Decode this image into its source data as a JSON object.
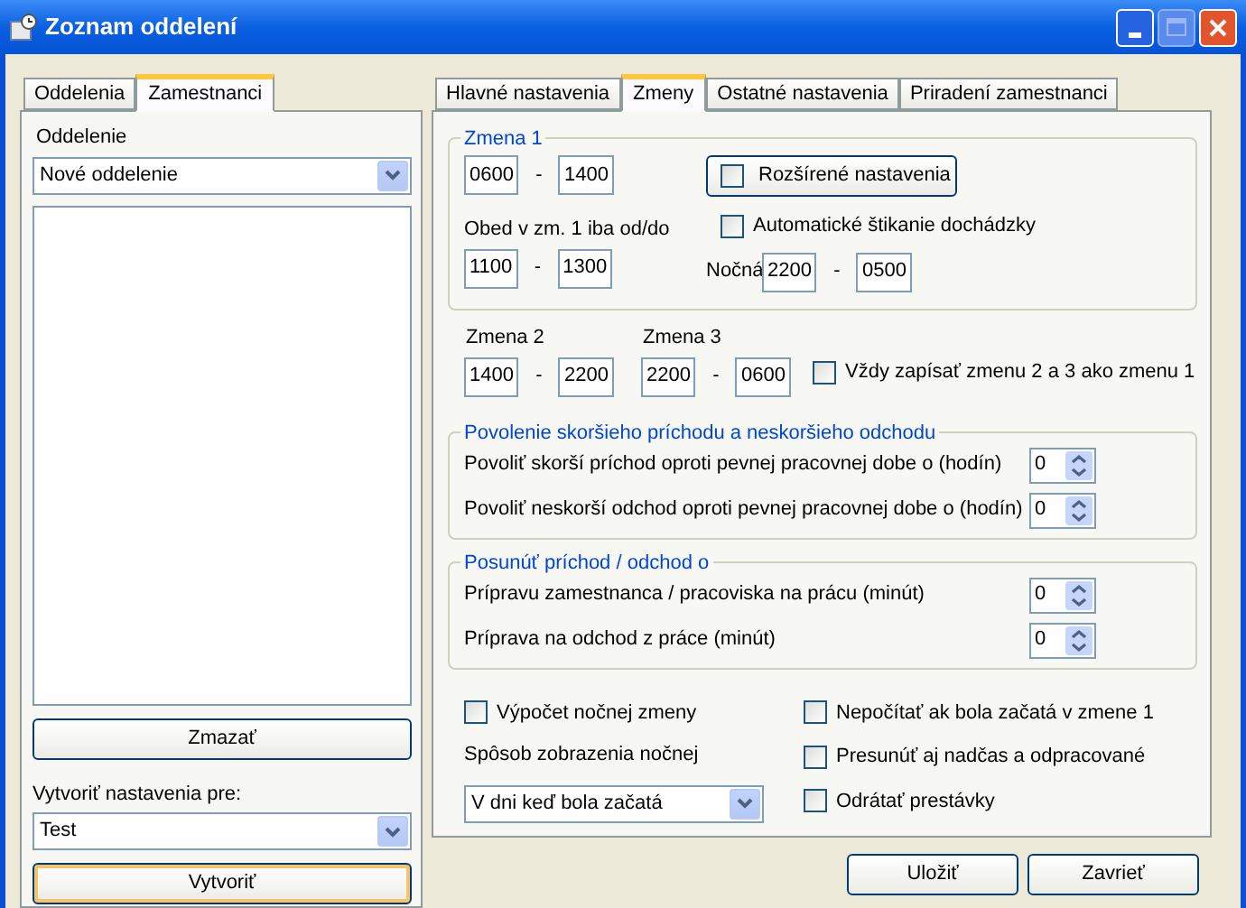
{
  "window": {
    "title": "Zoznam oddelení"
  },
  "left_tabs": [
    {
      "label": "Oddelenia",
      "selected": false
    },
    {
      "label": "Zamestnanci",
      "selected": true
    }
  ],
  "department": {
    "label": "Oddelenie",
    "value": "Nové oddelenie"
  },
  "delete_button": "Zmazať",
  "create_for": {
    "label": "Vytvoriť nastavenia pre:",
    "value": "Test"
  },
  "create_button": "Vytvoriť",
  "right_tabs": [
    {
      "label": "Hlavné nastavenia",
      "selected": false
    },
    {
      "label": "Zmeny",
      "selected": true
    },
    {
      "label": "Ostatné nastavenia",
      "selected": false
    },
    {
      "label": "Priradení zamestnanci",
      "selected": false
    }
  ],
  "shift1": {
    "title": "Zmena 1",
    "from": "0600",
    "to": "1400",
    "separator": "-",
    "advanced": {
      "label": "Rozšírené nastavenia",
      "checked": false
    },
    "lunch": {
      "label": "Obed v zm. 1 iba od/do",
      "from": "1100",
      "to": "1300"
    },
    "auto_punch": {
      "label": "Automatické štikanie dochádzky",
      "checked": false
    },
    "night": {
      "label": "Nočná",
      "from": "2200",
      "to": "0500"
    }
  },
  "shifts": [
    {
      "label": "Zmena 2",
      "from": "1400",
      "to": "2200"
    },
    {
      "label": "Zmena 3",
      "from": "2200",
      "to": "0600"
    }
  ],
  "always_write": {
    "label": "Vždy zapísať zmenu 2 a 3 ako zmenu 1",
    "checked": false
  },
  "groups": [
    {
      "title": "Povolenie skoršieho príchodu a neskoršieho odchodu",
      "rows": [
        {
          "label": "Povoliť skorší príchod oproti pevnej pracovnej dobe o (hodín)",
          "value": "0"
        },
        {
          "label": "Povoliť neskorší odchod oproti pevnej pracovnej dobe o (hodín)",
          "value": "0"
        }
      ]
    },
    {
      "title": "Posunúť príchod / odchod o",
      "rows": [
        {
          "label": "Prípravu zamestnanca / pracoviska na prácu (minút)",
          "value": "0"
        },
        {
          "label": "Príprava na odchod z práce (minút)",
          "value": "0"
        }
      ]
    }
  ],
  "night_calc": {
    "label": "Výpočet nočnej zmeny",
    "checked": false
  },
  "night_display": {
    "label": "Spôsob zobrazenia nočnej",
    "value": "V dni keď bola začatá"
  },
  "options": [
    {
      "label": "Nepočítať ak bola začatá v zmene 1",
      "checked": false
    },
    {
      "label": "Presunúť aj nadčas a odpracované",
      "checked": false
    },
    {
      "label": "Odrátať prestávky",
      "checked": false
    }
  ],
  "buttons": [
    "Uložiť",
    "Zavrieť"
  ]
}
